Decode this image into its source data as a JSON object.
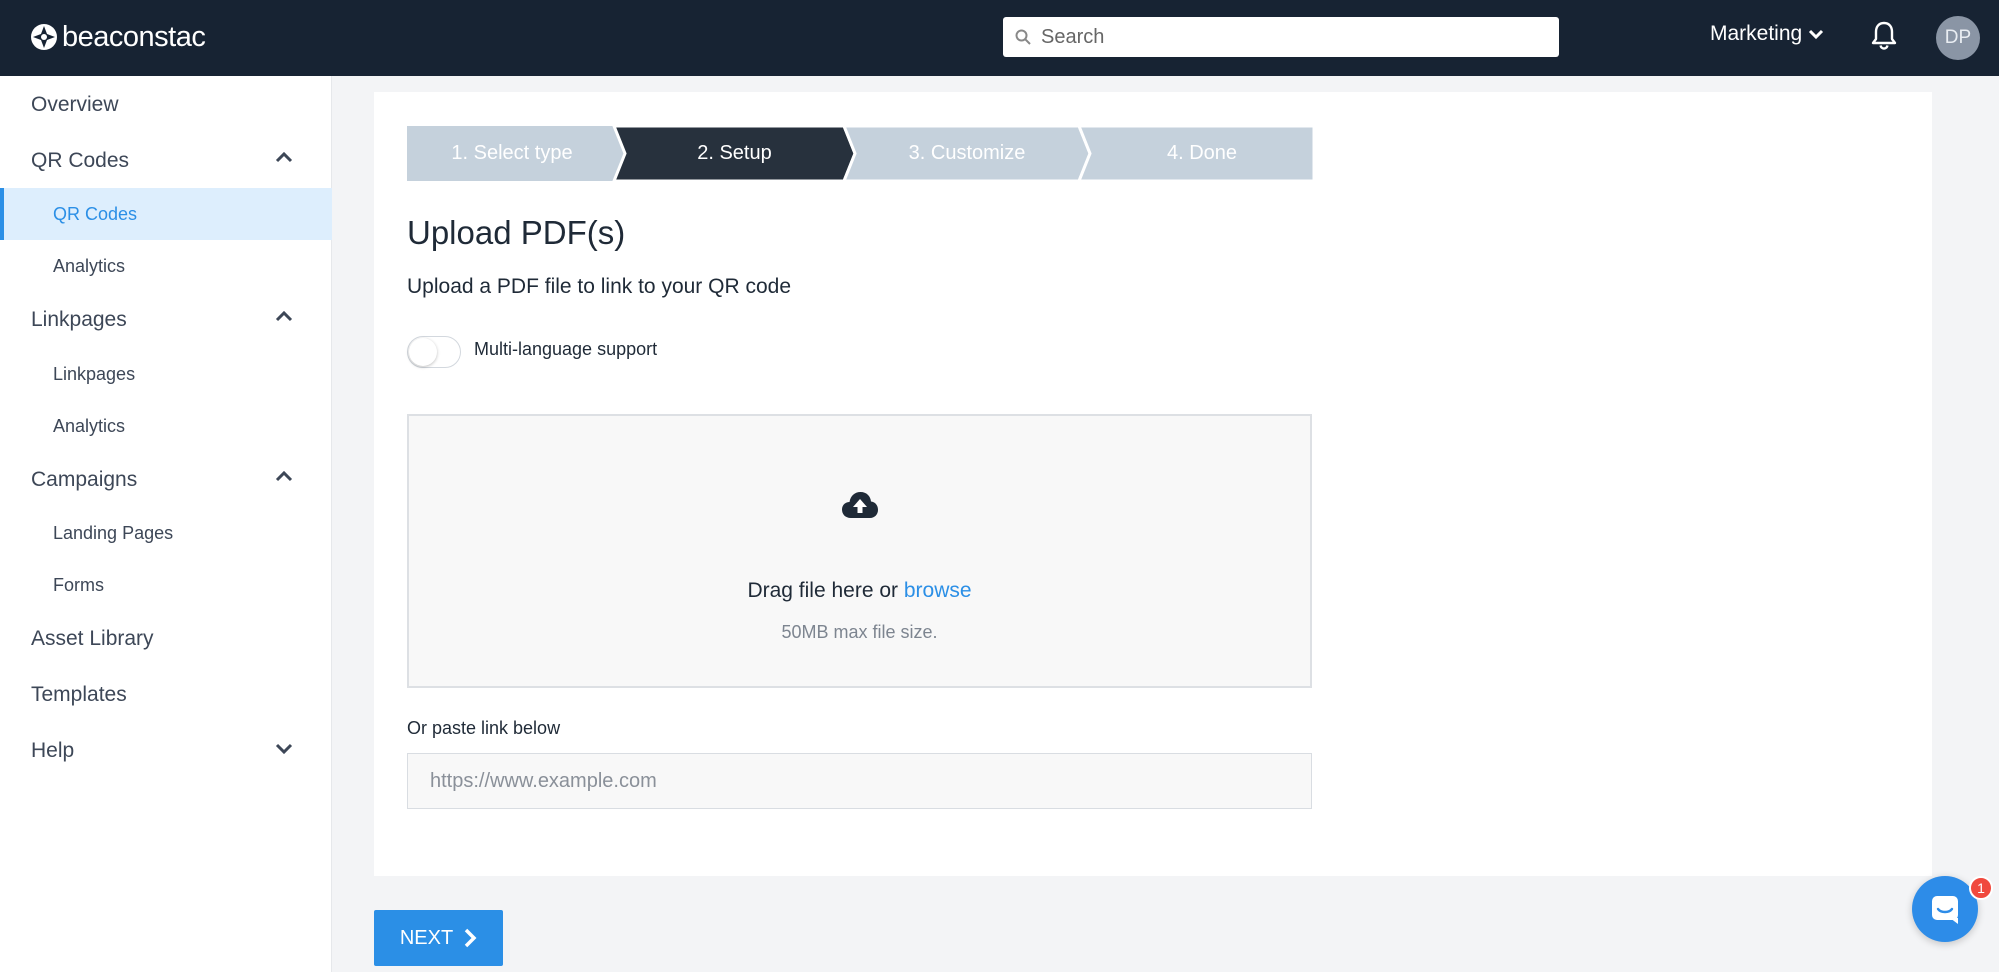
{
  "header": {
    "brand": "beaconstac",
    "search_placeholder": "Search",
    "org_label": "Marketing",
    "avatar_initials": "DP"
  },
  "sidebar": {
    "overview": "Overview",
    "qr_codes": "QR Codes",
    "qr_codes_sub": "QR Codes",
    "qr_analytics": "Analytics",
    "linkpages": "Linkpages",
    "linkpages_sub": "Linkpages",
    "linkpages_analytics": "Analytics",
    "campaigns": "Campaigns",
    "landing_pages": "Landing Pages",
    "forms": "Forms",
    "asset_library": "Asset Library",
    "templates": "Templates",
    "help": "Help"
  },
  "steps": [
    {
      "label": "1. Select type",
      "state": "done"
    },
    {
      "label": "2. Setup",
      "state": "active"
    },
    {
      "label": "3. Customize",
      "state": "todo"
    },
    {
      "label": "4. Done",
      "state": "todo"
    }
  ],
  "form": {
    "title": "Upload PDF(s)",
    "subtitle": "Upload a PDF file to link to your QR code",
    "toggle_label": "Multi-language support",
    "drag_text": "Drag file here or",
    "browse": "browse",
    "max_size": "50MB max file size.",
    "paste_label": "Or paste link below",
    "link_placeholder": "https://www.example.com"
  },
  "actions": {
    "next": "NEXT"
  },
  "chat": {
    "badge_count": "1"
  },
  "colors": {
    "topbar": "#172333",
    "accent": "#2b8fe6",
    "step_active": "#27313d",
    "step_inactive": "#c5d1dc"
  }
}
